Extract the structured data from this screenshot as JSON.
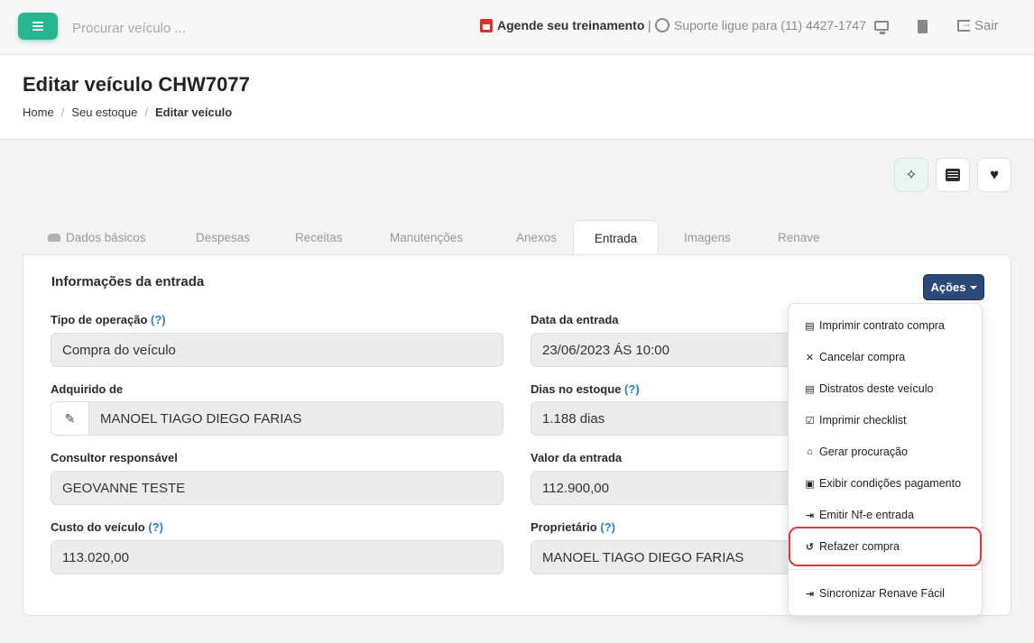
{
  "topbar": {
    "search_placeholder": "Procurar veículo ...",
    "training_label": "Agende seu treinamento",
    "separator": "|",
    "support_label": "Suporte ligue para (11) 4427-1747",
    "exit_label": "Sair"
  },
  "header": {
    "title": "Editar veículo CHW7077",
    "breadcrumb": [
      "Home",
      "Seu estoque",
      "Editar veículo"
    ],
    "breadcrumb_sep": "/"
  },
  "tabs": [
    "Dados básicos",
    "Despesas",
    "Receitas",
    "Manutenções",
    "Anexos",
    "Entrada",
    "Imagens",
    "Renave"
  ],
  "active_tab": "Entrada",
  "section": {
    "title": "Informações da entrada",
    "actions_label": "Ações"
  },
  "fields": {
    "tipo_operacao": {
      "label": "Tipo de operação",
      "help": "(?)",
      "value": "Compra do veículo"
    },
    "data_entrada": {
      "label": "Data da entrada",
      "value": "23/06/2023 ÁS 10:00"
    },
    "adquirido_de": {
      "label": "Adquirido de",
      "value": "MANOEL  TIAGO DIEGO FARIAS"
    },
    "dias_estoque": {
      "label": "Dias no estoque",
      "help": "(?)",
      "value": "1.188 dias"
    },
    "consultor": {
      "label": "Consultor responsável",
      "value": "GEOVANNE TESTE"
    },
    "valor_entrada": {
      "label": "Valor da entrada",
      "value": "112.900,00"
    },
    "custo": {
      "label": "Custo do veículo",
      "help": "(?)",
      "value": "113.020,00"
    },
    "proprietario": {
      "label": "Proprietário",
      "help": "(?)",
      "value": "MANOEL  TIAGO DIEGO FARIAS"
    }
  },
  "actions_menu": [
    {
      "label": "Imprimir contrato compra",
      "icon": "file-icon"
    },
    {
      "label": "Cancelar compra",
      "icon": "times-icon"
    },
    {
      "label": "Distratos deste veículo",
      "icon": "file-icon"
    },
    {
      "label": "Imprimir checklist",
      "icon": "check-square-icon"
    },
    {
      "label": "Gerar procuração",
      "icon": "bank-icon"
    },
    {
      "label": "Exibir condições pagamento",
      "icon": "money-icon"
    },
    {
      "label": "Emitir Nf-e entrada",
      "icon": "sign-in-icon"
    },
    {
      "label": "Refazer compra",
      "icon": "history-icon"
    },
    {
      "label": "Sincronizar Renave Fácil",
      "icon": "sign-in-icon"
    }
  ],
  "colors": {
    "brand_green": "#25b58f",
    "actions_button": "#2b4a78",
    "highlight": "#d83b3b",
    "help_link": "#2d7fb8"
  }
}
